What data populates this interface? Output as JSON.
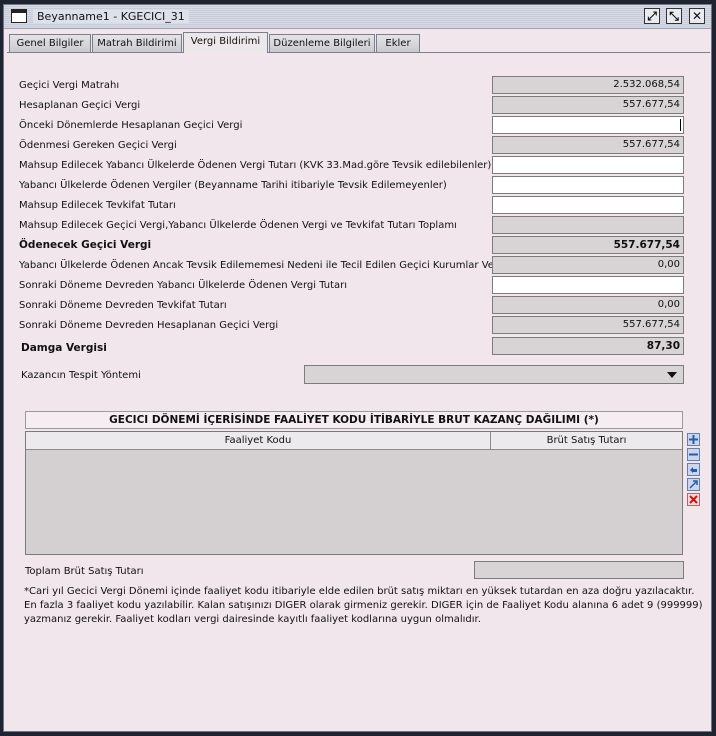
{
  "window": {
    "title": "Beyanname1 - KGECICI_31",
    "buttons": {
      "restore": "⤢",
      "maximize": "⤡",
      "close": "✕"
    }
  },
  "tabs": [
    {
      "label": "Genel Bilgiler",
      "active": false
    },
    {
      "label": "Matrah Bildirimi",
      "active": false
    },
    {
      "label": "Vergi Bildirimi",
      "active": true
    },
    {
      "label": "Düzenleme Bilgileri",
      "active": false
    },
    {
      "label": "Ekler",
      "active": false
    }
  ],
  "rows": [
    {
      "label": "Geçici Vergi Matrahı",
      "value": "2.532.068,54",
      "readonly": true,
      "bold": false
    },
    {
      "label": "Hesaplanan Geçici Vergi",
      "value": "557.677,54",
      "readonly": true,
      "bold": false
    },
    {
      "label": "Önceki Dönemlerde Hesaplanan Geçici Vergi",
      "value": "",
      "readonly": false,
      "bold": false
    },
    {
      "label": "Ödenmesi Gereken Geçici Vergi",
      "value": "557.677,54",
      "readonly": true,
      "bold": false
    },
    {
      "label": "Mahsup Edilecek Yabancı Ülkelerde Ödenen Vergi Tutarı (KVK 33.Mad.göre Tevsik edilebilenler)",
      "value": "",
      "readonly": false,
      "bold": false
    },
    {
      "label": "Yabancı Ülkelerde Ödenen Vergiler (Beyanname Tarihi itibariyle Tevsik Edilemeyenler)",
      "value": "",
      "readonly": false,
      "bold": false
    },
    {
      "label": "Mahsup Edilecek Tevkifat Tutarı",
      "value": "",
      "readonly": false,
      "bold": false
    },
    {
      "label": "Mahsup Edilecek Geçici Vergi,Yabancı Ülkelerde Ödenen Vergi ve Tevkifat Tutarı Toplamı",
      "value": "",
      "readonly": true,
      "bold": false
    },
    {
      "label": "Ödenecek Geçici Vergi",
      "value": "557.677,54",
      "readonly": true,
      "bold": true
    },
    {
      "label": "Yabancı Ülkelerde Ödenen Ancak Tevsik Edilememesi Nedeni ile Tecil Edilen Geçici Kurumlar Vergisi",
      "value": "0,00",
      "readonly": true,
      "bold": false
    },
    {
      "label": "Sonraki Döneme Devreden Yabancı Ülkelerde Ödenen Vergi Tutarı",
      "value": "",
      "readonly": false,
      "bold": false
    },
    {
      "label": "Sonraki Döneme Devreden Tevkifat Tutarı",
      "value": "0,00",
      "readonly": true,
      "bold": false
    },
    {
      "label": "Sonraki Döneme Devreden Hesaplanan Geçici Vergi",
      "value": "557.677,54",
      "readonly": true,
      "bold": false
    },
    {
      "label": "Damga Vergisi",
      "value": "87,30",
      "readonly": true,
      "bold": true
    }
  ],
  "kazanc": {
    "label": "Kazancın Tespit Yöntemi",
    "value": ""
  },
  "table": {
    "title": "GECICI DÖNEMİ İÇERİSİNDE FAALİYET KODU İTİBARİYLE BRUT KAZANÇ DAĞILIMI (*)",
    "columns": [
      "Faaliyet Kodu",
      "Brüt Satış Tutarı"
    ],
    "side_buttons": [
      "add-row-icon",
      "remove-row-icon",
      "undo-icon",
      "import-icon",
      "delete-icon"
    ]
  },
  "toplam": {
    "label": "Toplam Brüt Satış Tutarı",
    "value": ""
  },
  "footnote": [
    "*Cari yıl Gecici Vergi Dönemi içinde faaliyet kodu itibariyle elde edilen brüt satış miktarı en yüksek tutardan en aza doğru yazılacaktır.",
    "En fazla 3 faaliyet kodu yazılabilir. Kalan satışınızı DIGER olarak girmeniz gerekir. DIGER için de Faaliyet Kodu alanına 6 adet 9 (999999)",
    "yazmanız gerekir. Faaliyet kodları vergi dairesinde kayıtlı faaliyet kodlarına uygun olmalıdır."
  ],
  "colors": {
    "panel": "#f1e6ec",
    "readonly": "#d8d4d6",
    "writable": "#ffffff"
  }
}
